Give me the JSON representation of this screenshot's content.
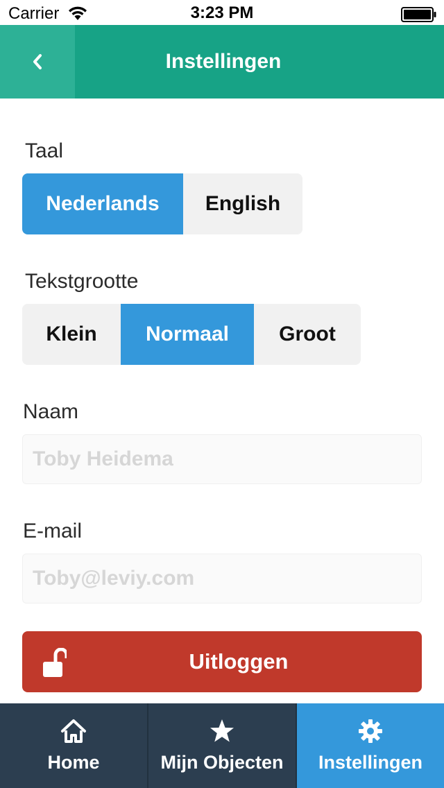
{
  "status_bar": {
    "carrier": "Carrier",
    "time": "3:23 PM",
    "icons": [
      "wifi-icon",
      "battery-icon"
    ]
  },
  "nav": {
    "title": "Instellingen",
    "back_icon": "chevron-left-icon",
    "color": "#17a386"
  },
  "language": {
    "label": "Taal",
    "options": [
      "Nederlands",
      "English"
    ],
    "selected": "Nederlands"
  },
  "text_size": {
    "label": "Tekstgrootte",
    "options": [
      "Klein",
      "Normaal",
      "Groot"
    ],
    "selected": "Normaal"
  },
  "name": {
    "label": "Naam",
    "placeholder": "Toby Heidema",
    "value": ""
  },
  "email": {
    "label": "E-mail",
    "placeholder": "Toby@leviy.com",
    "value": ""
  },
  "logout": {
    "label": "Uitloggen",
    "icon": "unlock-icon",
    "color": "#c0392b"
  },
  "tabs": [
    {
      "label": "Home",
      "icon": "home-icon",
      "active": false
    },
    {
      "label": "Mijn Objecten",
      "icon": "star-icon",
      "active": false
    },
    {
      "label": "Instellingen",
      "icon": "gear-icon",
      "active": true
    }
  ],
  "colors": {
    "accent": "#3498db",
    "tab_bar": "#2c3e50",
    "segment_bg": "#f1f1f1"
  }
}
